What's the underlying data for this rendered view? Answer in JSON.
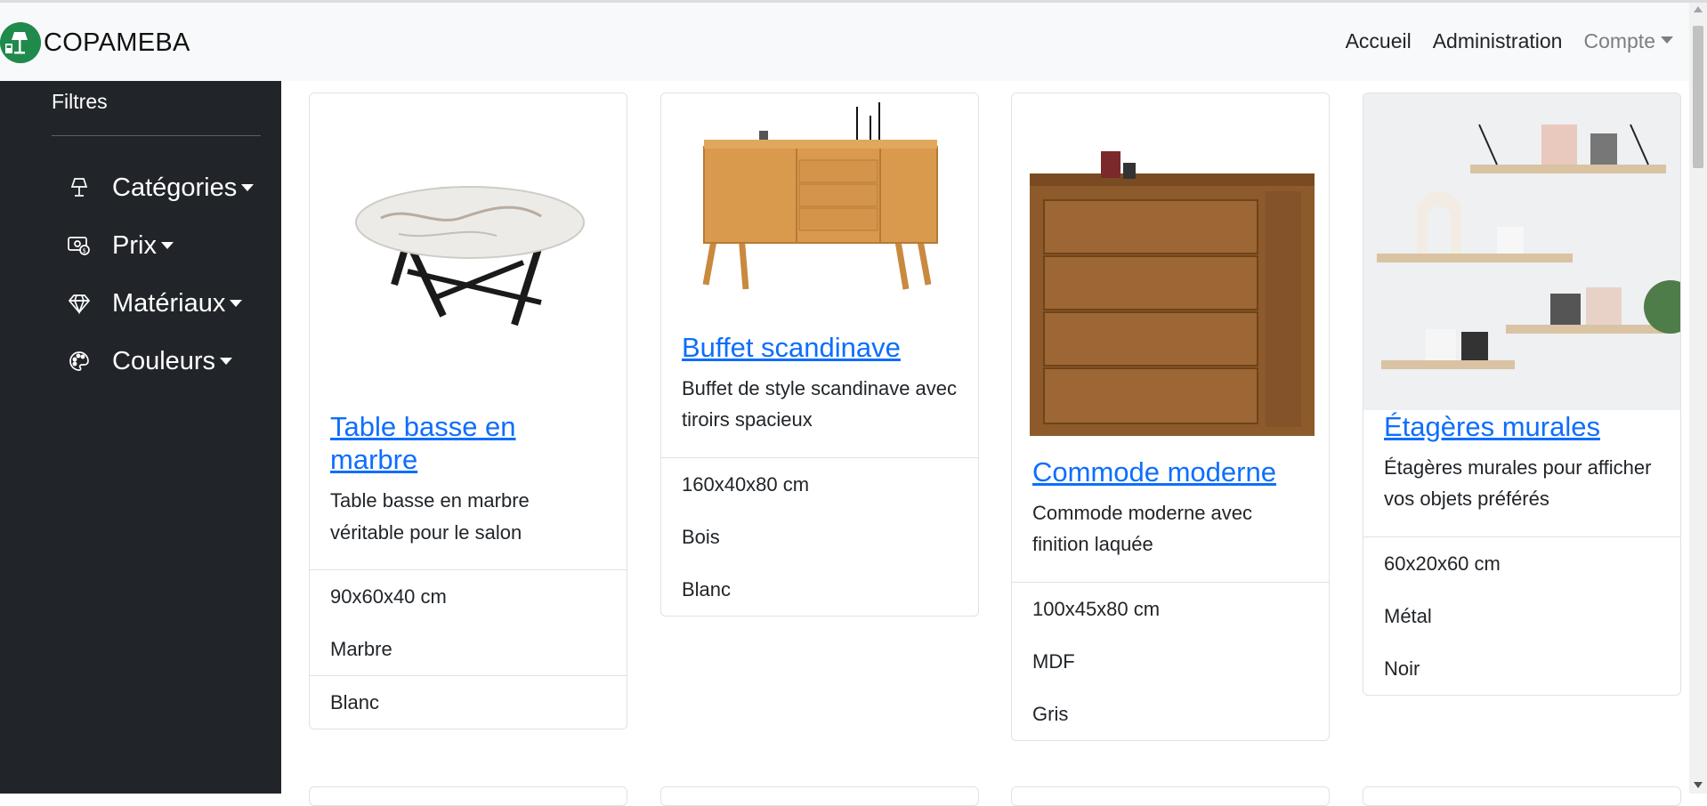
{
  "brand": {
    "name": "COPAMEBA"
  },
  "nav": {
    "home": "Accueil",
    "admin": "Administration",
    "account": "Compte"
  },
  "sidebar": {
    "title": "Filtres",
    "items": [
      {
        "label": "Catégories",
        "icon": "lamp-icon"
      },
      {
        "label": "Prix",
        "icon": "money-icon"
      },
      {
        "label": "Matériaux",
        "icon": "diamond-icon"
      },
      {
        "label": "Couleurs",
        "icon": "palette-icon"
      }
    ]
  },
  "products": [
    {
      "title": "Table basse en marbre",
      "description": "Table basse en marbre véritable pour le salon",
      "dimensions": "90x60x40 cm",
      "material": "Marbre",
      "color": "Blanc"
    },
    {
      "title": "Buffet scandinave",
      "description": "Buffet de style scandinave avec tiroirs spacieux",
      "dimensions": "160x40x80 cm",
      "material": "Bois",
      "color": "Blanc"
    },
    {
      "title": "Commode moderne",
      "description": "Commode moderne avec finition laquée",
      "dimensions": "100x45x80 cm",
      "material": "MDF",
      "color": "Gris"
    },
    {
      "title": "Étagères murales",
      "description": "Étagères murales pour afficher vos objets préférés",
      "dimensions": "60x20x60 cm",
      "material": "Métal",
      "color": "Noir"
    }
  ]
}
